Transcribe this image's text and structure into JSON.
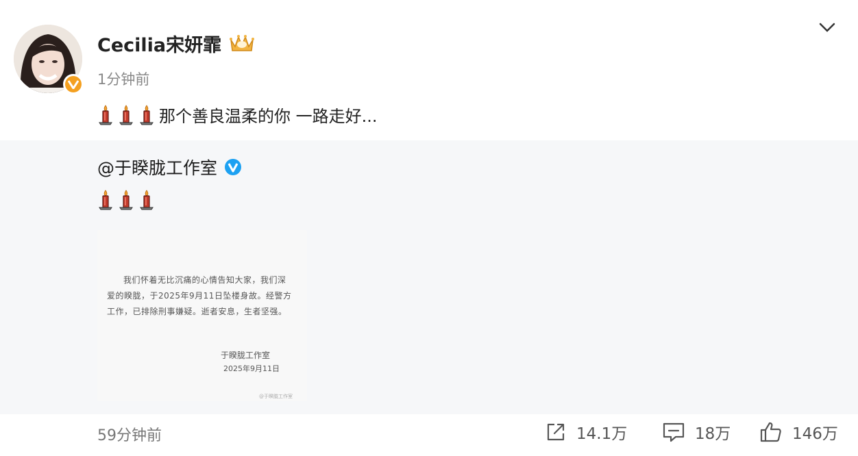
{
  "post": {
    "username": "Cecilia宋妍霏",
    "time": "1分钟前",
    "text": "那个善良温柔的你 一路走好...",
    "candle_count": 3
  },
  "repost": {
    "author": "@于睽胧工作室",
    "candle_count": 3,
    "notice": {
      "body": "我们怀着无比沉痛的心情告知大家，我们深爱的睽胧，于2025年9月11日坠楼身故。经警方工作，已排除刑事嫌疑。逝者安息，生者坚强。",
      "signature": "于睽胧工作室",
      "date": "2025年9月11日",
      "watermark": "@于睽胧工作室"
    }
  },
  "footer": {
    "time": "59分钟前",
    "repost_count": "14.1万",
    "comment_count": "18万",
    "like_count": "146万"
  },
  "colors": {
    "repost_background": "#f6f7f9",
    "gold_badge": "#f4a020",
    "blue_badge": "#1da1f2"
  },
  "icons": [
    "chevron-down-icon",
    "crown-icon",
    "candle-icon",
    "blue-verified-icon",
    "repost-icon",
    "comment-icon",
    "like-icon"
  ]
}
